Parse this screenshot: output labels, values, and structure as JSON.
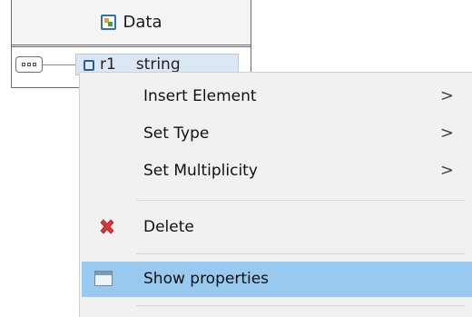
{
  "node": {
    "title": "Data",
    "title_icon": "data-structure-icon",
    "element": {
      "name": "r1",
      "type": "string"
    }
  },
  "menu": {
    "items": [
      {
        "label": "Insert Element",
        "has_submenu": true
      },
      {
        "label": "Set Type",
        "has_submenu": true
      },
      {
        "label": "Set Multiplicity",
        "has_submenu": true
      },
      {
        "label": "Delete",
        "icon": "delete-x-icon"
      },
      {
        "label": "Show properties",
        "icon": "properties-window-icon",
        "selected": true
      }
    ],
    "submenu_arrow": ">"
  },
  "colors": {
    "menu_bg": "#f1f1f1",
    "selected_bg": "#99c9ef",
    "element_bg": "#dbe7f3",
    "delete_red": "#d9363e"
  }
}
